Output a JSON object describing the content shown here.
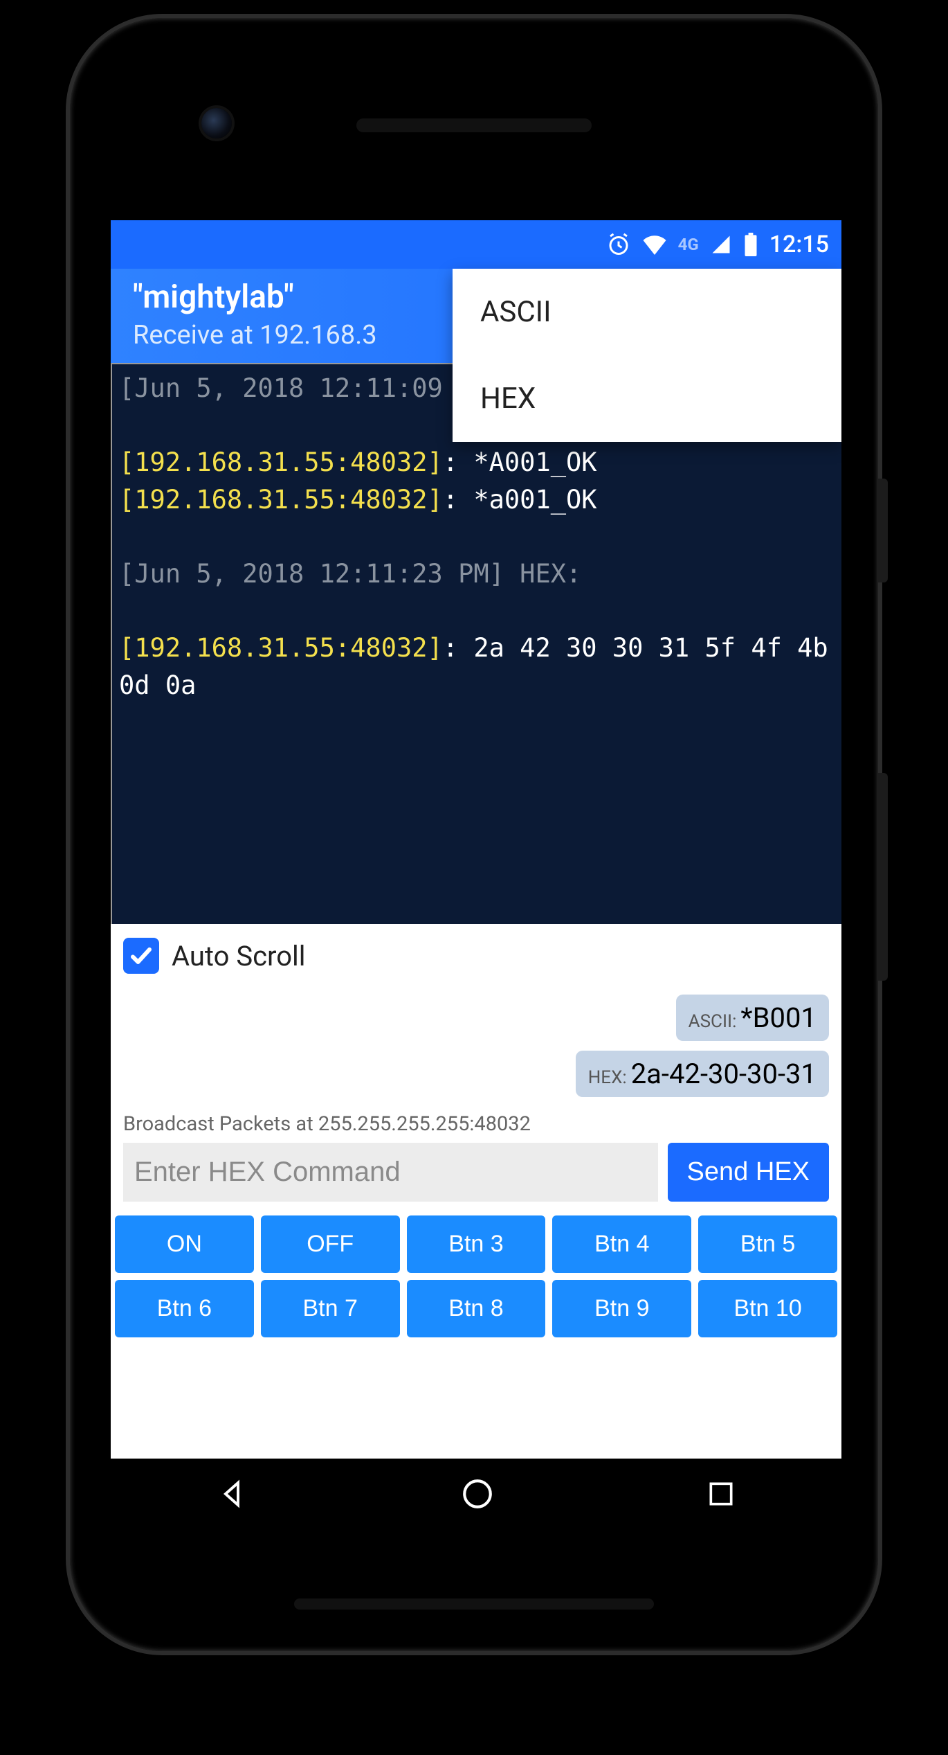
{
  "status": {
    "time": "12:15",
    "net_label": "4G"
  },
  "appbar": {
    "title": "\"mightylab\"",
    "subtitle": "Receive at 192.168.3"
  },
  "menu": {
    "item_ascii": "ASCII",
    "item_hex": "HEX"
  },
  "term": {
    "ts1": "[Jun 5, 2018 12:11:09 PM",
    "addr1": "[192.168.31.55:48032]",
    "msg1": ": *A001_OK",
    "addr2": "[192.168.31.55:48032]",
    "msg2": ": *a001_OK",
    "ts2": "[Jun 5, 2018 12:11:23 PM] HEX:",
    "addr3": "[192.168.31.55:48032]",
    "msg3": ": 2a 42 30 30 31 5f 4f 4b 0d 0a"
  },
  "autoscroll_label": "Auto Scroll",
  "pill_ascii": {
    "prefix": "ASCII:",
    "value": "*B001"
  },
  "pill_hex": {
    "prefix": "HEX:",
    "value": "2a-42-30-30-31"
  },
  "broadcast": "Broadcast Packets at 255.255.255.255:48032",
  "input": {
    "placeholder": "Enter HEX Command",
    "send_label": "Send HEX"
  },
  "buttons": {
    "b0": "ON",
    "b1": "OFF",
    "b2": "Btn 3",
    "b3": "Btn 4",
    "b4": "Btn 5",
    "b5": "Btn 6",
    "b6": "Btn 7",
    "b7": "Btn 8",
    "b8": "Btn 9",
    "b9": "Btn 10"
  }
}
